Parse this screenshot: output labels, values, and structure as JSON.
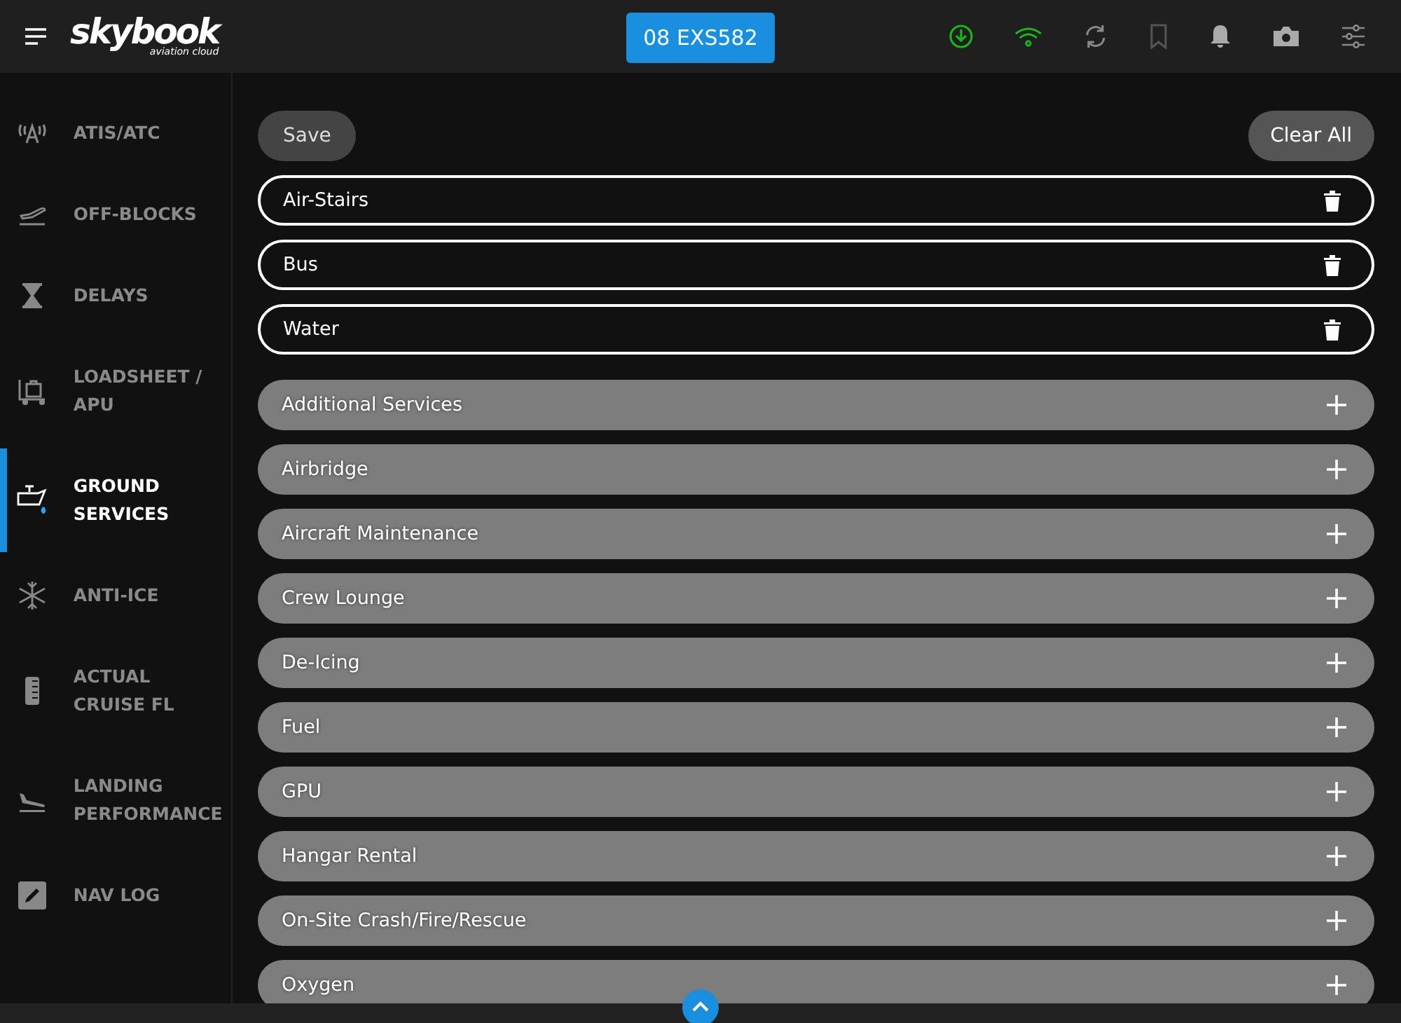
{
  "header": {
    "logo": "skybook",
    "logo_tagline": "aviation cloud",
    "flight_button": "08 EXS582"
  },
  "sidebar": {
    "items": [
      {
        "label": "ATIS/ATC",
        "selected": false
      },
      {
        "label": "OFF-BLOCKS",
        "selected": false
      },
      {
        "label": "DELAYS",
        "selected": false
      },
      {
        "label": "LOADSHEET / APU",
        "selected": false
      },
      {
        "label": "GROUND SERVICES",
        "selected": true
      },
      {
        "label": "ANTI-ICE",
        "selected": false
      },
      {
        "label": "ACTUAL CRUISE FL",
        "selected": false
      },
      {
        "label": "LANDING PERFORMANCE",
        "selected": false
      },
      {
        "label": "NAV LOG",
        "selected": false
      }
    ]
  },
  "toolbar": {
    "save_button": "Save",
    "clear_button": "Clear All"
  },
  "added_services": [
    {
      "label": "Air-Stairs"
    },
    {
      "label": "Bus"
    },
    {
      "label": "Water"
    }
  ],
  "available_services": [
    {
      "label": "Additional Services"
    },
    {
      "label": "Airbridge"
    },
    {
      "label": "Aircraft Maintenance"
    },
    {
      "label": "Crew Lounge"
    },
    {
      "label": "De-Icing"
    },
    {
      "label": "Fuel"
    },
    {
      "label": "GPU"
    },
    {
      "label": "Hangar Rental"
    },
    {
      "label": "On-Site Crash/Fire/Rescue"
    },
    {
      "label": "Oxygen"
    }
  ]
}
